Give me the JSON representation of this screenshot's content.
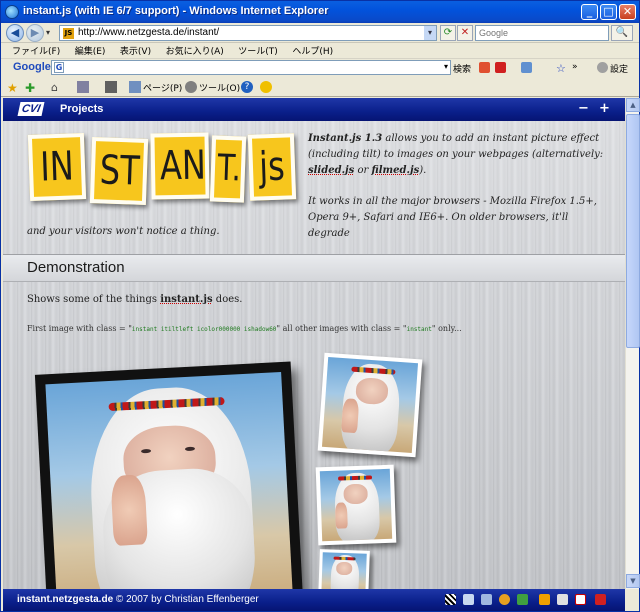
{
  "window": {
    "title": "instant.js (with IE 6/7 support) - Windows Internet Explorer",
    "minimize": "_",
    "maximize": "□",
    "close": "✕"
  },
  "address": {
    "favicon": "JS",
    "url": "http://www.netzgesta.de/instant/",
    "search_placeholder": "Google"
  },
  "menu": [
    "ファイル(F)",
    "編集(E)",
    "表示(V)",
    "お気に入り(A)",
    "ツール(T)",
    "ヘルプ(H)"
  ],
  "google_toolbar": {
    "logo": "Google",
    "search_label": "検索",
    "settings_label": "設定"
  },
  "command_bar": {
    "page_label": "ページ(P)",
    "tools_label": "ツール(O)"
  },
  "site": {
    "brand": "CVI",
    "nav_label": "Projects",
    "minus": "−",
    "plus": "+",
    "logo_letters": [
      "IN",
      "ST",
      "AN",
      "T.",
      "js"
    ],
    "intro_title": "Instant.js 1.3",
    "intro_text": " allows you to add an instant picture effect (including tilt) to images on your webpages (alternatively: ",
    "link_slided": "slided.js",
    "intro_or": " or ",
    "link_filmed": "filmed.js",
    "intro_end": ").",
    "browsers_text": "It works in all the major browsers - Mozilla Firefox 1.5+, Opera 9+, Safari and IE6+. On older browsers, it'll degrade",
    "degrade_text": "and your visitors won't notice a thing.",
    "section_title": "Demonstration",
    "desc_pre": "Shows some of the things ",
    "desc_link": "instant.js",
    "desc_post": " does.",
    "class_pre": "First image with class = \"",
    "class_code1": "instant itiltleft icolor000000 ishadow60",
    "class_mid": "\" all other images with class = \"",
    "class_code2": "instant",
    "class_post": "\" only..."
  },
  "status": {
    "site_bold": "instant.netzgesta.de",
    "copyright": " © 2007 by Christian Effenberger"
  }
}
